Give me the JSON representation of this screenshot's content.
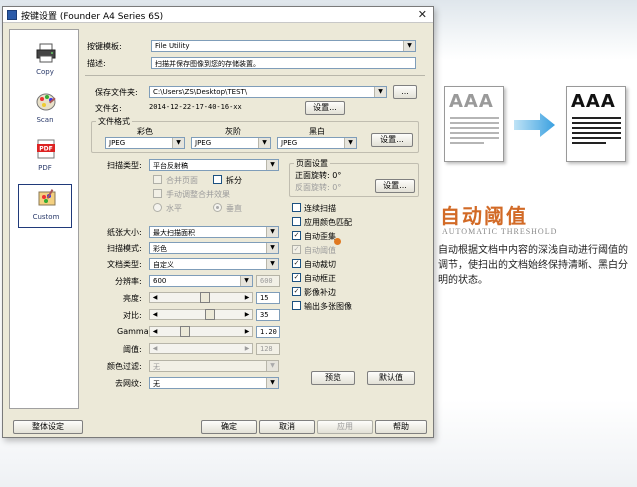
{
  "window": {
    "title": "按键设置 (Founder A4 Series 6S)"
  },
  "sidebar": {
    "items": [
      {
        "label": "Copy",
        "icon": "printer-icon"
      },
      {
        "label": "Scan",
        "icon": "paint-palette-icon"
      },
      {
        "label": "PDF",
        "icon": "pdf-icon"
      },
      {
        "label": "Custom",
        "icon": "custom-palette-icon"
      }
    ],
    "selected": "Custom"
  },
  "template": {
    "label": "按键模板:",
    "value": "File Utility"
  },
  "description": {
    "label": "描述:",
    "value": "扫描并保存图像到您的存储装置。"
  },
  "save_folder": {
    "label": "保存文件夹:",
    "value": "C:\\Users\\ZS\\Desktop\\TEST\\",
    "browse": "..."
  },
  "file_name": {
    "label": "文件名:",
    "value": "2014-12-22-17-40-16-xx",
    "button": "设置..."
  },
  "file_format": {
    "title": "文件格式",
    "color_label": "彩色",
    "gray_label": "灰阶",
    "bw_label": "黑白",
    "color_value": "JPEG",
    "gray_value": "JPEG",
    "bw_value": "JPEG",
    "button": "设置..."
  },
  "scan_type": {
    "label": "扫描类型:",
    "value": "平台反射稿",
    "merge_pages": "合并页面",
    "split": "拆分",
    "manual_merge": "手动调整合并效果",
    "horizontal": "水平",
    "vertical": "垂直"
  },
  "page_settings": {
    "title": "页面设置",
    "front_rotation": "正面旋转: 0°",
    "back_rotation": "反面旋转: 0°",
    "button": "设置..."
  },
  "options": [
    {
      "label": "连续扫描",
      "checked": false,
      "disabled": false
    },
    {
      "label": "应用颜色匹配",
      "checked": false,
      "disabled": false
    },
    {
      "label": "自动歪集",
      "checked": true,
      "disabled": false
    },
    {
      "label": "自动阈值",
      "checked": true,
      "disabled": true
    },
    {
      "label": "自动裁切",
      "checked": true,
      "disabled": false
    },
    {
      "label": "自动框正",
      "checked": true,
      "disabled": false
    },
    {
      "label": "影像补边",
      "checked": true,
      "disabled": false
    },
    {
      "label": "输出多张图像",
      "checked": false,
      "disabled": false
    }
  ],
  "paper_size": {
    "label": "纸张大小:",
    "value": "最大扫描面积"
  },
  "scan_mode": {
    "label": "扫描模式:",
    "value": "彩色"
  },
  "doc_type": {
    "label": "文档类型:",
    "value": "自定义"
  },
  "resolution": {
    "label": "分辨率:",
    "value": "600",
    "value2": "600"
  },
  "brightness": {
    "label": "亮度:",
    "value": "15",
    "level": 0.56
  },
  "contrast": {
    "label": "对比:",
    "value": "35",
    "level": 0.62
  },
  "gamma": {
    "label": "Gamma:",
    "value": "1.20",
    "level": 0.28
  },
  "threshold": {
    "label": "阈值:",
    "value": "128",
    "level": 0.5
  },
  "color_filter": {
    "label": "颜色过滤:",
    "value": "无"
  },
  "descreen": {
    "label": "去网纹:",
    "value": "无"
  },
  "buttons": {
    "preview": "预览",
    "default": "默认值",
    "global_settings": "整体设定",
    "ok": "确定",
    "cancel": "取消",
    "apply": "应用",
    "help": "帮助"
  },
  "feature": {
    "big_letters": "AAA",
    "title": "自动阈值",
    "subtitle": "AUTOMATIC THRESHOLD",
    "description": "自动根据文档中内容的深浅自动进行阈值的调节，使扫出的文档始终保持清晰、黑白分明的状态。",
    "accent_color": "#d26a26",
    "arrow_color": "#3aa0e0"
  }
}
